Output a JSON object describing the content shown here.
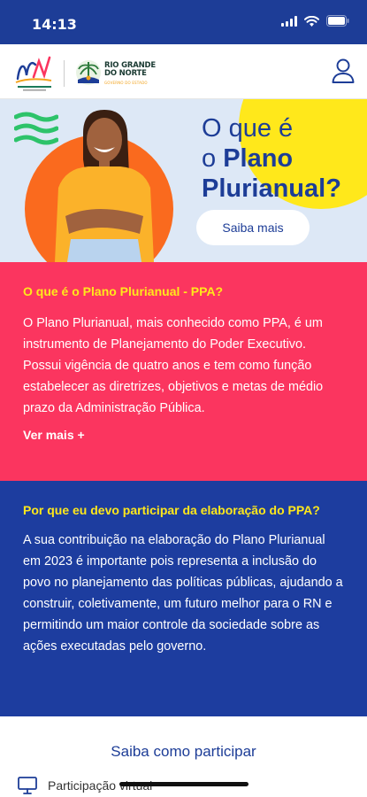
{
  "status_bar": {
    "time": "14:13"
  },
  "header": {
    "logo_gov_line1": "RIO GRANDE",
    "logo_gov_line2": "DO NORTE",
    "logo_gov_sub": "GOVERNO DO ESTADO"
  },
  "hero": {
    "title_line1": "O que é",
    "title_prefix": "o ",
    "title_strong": "Plano",
    "title_line3": "Plurianual?",
    "button_label": "Saiba mais"
  },
  "section_ppa": {
    "question": "O que é o Plano Plurianual - PPA?",
    "body": "O Plano Plurianual, mais conhecido como PPA, é um instrumento de Planejamento do Poder Executivo. Possui vigência de quatro anos e tem como função estabelecer as diretrizes, objetivos e metas de médio prazo da Administração Pública.",
    "more_label": "Ver mais +"
  },
  "section_why": {
    "question": "Por que eu devo participar da elaboração do PPA?",
    "body": "A sua contribuição na elaboração do Plano Plurianual em 2023 é importante pois representa a inclusão do povo no planejamento das políticas públicas, ajudando a construir, coletivamente, um futuro melhor para o RN e permitindo um maior controle da sociedade sobre as ações executadas pelo governo."
  },
  "participate": {
    "title": "Saiba como participar",
    "virtual_label": "Participação virtual"
  },
  "colors": {
    "brand_blue": "#1d3d97",
    "pink": "#fb355f",
    "yellow": "#ffe81b",
    "orange": "#fa6a1e",
    "hero_bg": "#dde8f6"
  },
  "icons": [
    "signal-icon",
    "wifi-icon",
    "battery-icon",
    "user-icon",
    "monitor-icon",
    "waves-icon"
  ]
}
